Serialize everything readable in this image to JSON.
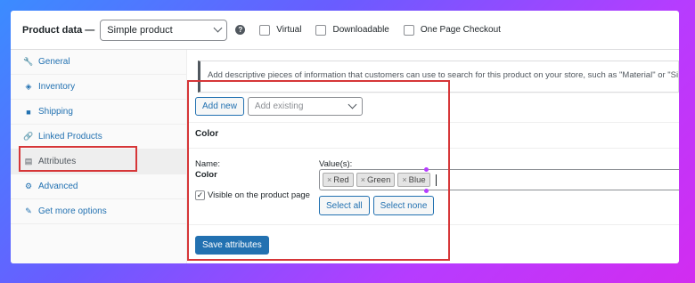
{
  "header": {
    "title": "Product data —",
    "product_type": "Simple product",
    "help_glyph": "?",
    "checkboxes": [
      {
        "label": "Virtual",
        "checked": false
      },
      {
        "label": "Downloadable",
        "checked": false
      },
      {
        "label": "One Page Checkout",
        "checked": false
      }
    ]
  },
  "sidebar": {
    "items": [
      {
        "label": "General",
        "icon": "wrench-icon",
        "glyph": "🔧"
      },
      {
        "label": "Inventory",
        "icon": "inventory-icon",
        "glyph": "◈"
      },
      {
        "label": "Shipping",
        "icon": "truck-icon",
        "glyph": "■"
      },
      {
        "label": "Linked Products",
        "icon": "link-icon",
        "glyph": "🔗"
      },
      {
        "label": "Attributes",
        "icon": "table-icon",
        "glyph": "▤",
        "active": true
      },
      {
        "label": "Advanced",
        "icon": "gear-icon",
        "glyph": "⚙"
      },
      {
        "label": "Get more options",
        "icon": "plug-icon",
        "glyph": "✎"
      }
    ]
  },
  "main": {
    "description": "Add descriptive pieces of information that customers can use to search for this product on your store, such as \"Material\" or \"Size\".",
    "add_new_label": "Add new",
    "add_existing_placeholder": "Add existing",
    "attribute": {
      "title": "Color",
      "name_label": "Name:",
      "name_value": "Color",
      "values_label": "Value(s):",
      "values": [
        "Red",
        "Green",
        "Blue"
      ],
      "chip_remove_glyph": "×",
      "visible_label": "Visible on the product page",
      "visible_checked": true,
      "check_glyph": "✓",
      "select_all_label": "Select all",
      "select_none_label": "Select none"
    },
    "save_label": "Save attributes"
  },
  "colors": {
    "accent": "#2271b1",
    "highlight": "#d63638"
  }
}
